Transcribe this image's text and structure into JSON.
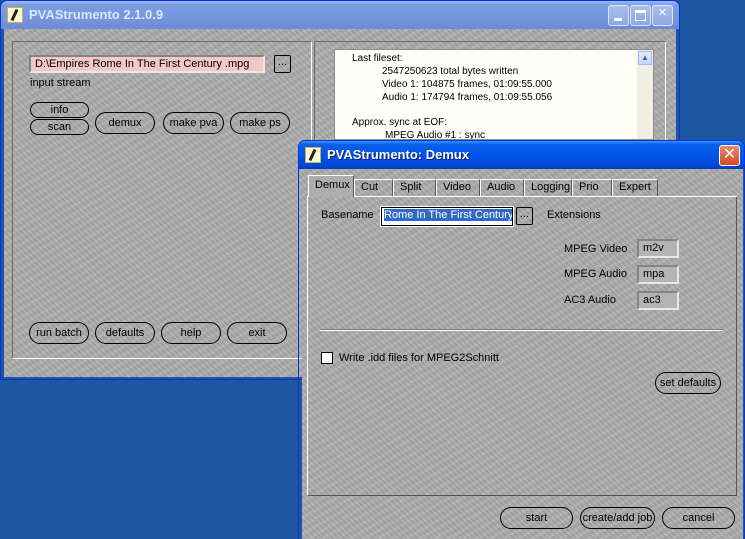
{
  "main_window": {
    "title": "PVAStrumento 2.1.0.9",
    "input_path": "D:\\Empires  Rome In The First Century .mpg",
    "browse_label": "...",
    "input_label": "input stream",
    "buttons": {
      "info": "info",
      "scan": "scan",
      "demux": "demux",
      "make_pva": "make pva",
      "make_ps": "make ps",
      "run_batch": "run batch",
      "defaults": "defaults",
      "help": "help",
      "exit": "exit"
    },
    "log": [
      "Last fileset:",
      "2547250623 total bytes written",
      "Video 1: 104875 frames, 01:09:55.000",
      "Audio 1: 174794 frames, 01:09:55.056",
      "Approx. sync at EOF:",
      "MPEG Audio #1 : sync"
    ],
    "scroll_up_glyph": "▲"
  },
  "demux_window": {
    "title": "PVAStrumento: Demux",
    "close_glyph": "✕",
    "tabs": [
      "Demux",
      "Cut",
      "Split",
      "Video",
      "Audio",
      "Logging",
      "Prio",
      "Expert"
    ],
    "selected_tab": "Demux",
    "basename_label": "Basename",
    "basename_value": "Rome In The First Century",
    "browse_label": "...",
    "extensions_label": "Extensions",
    "mpeg_video_label": "MPEG Video",
    "mpeg_video_value": "m2v",
    "mpeg_audio_label": "MPEG Audio",
    "mpeg_audio_value": "mpa",
    "ac3_audio_label": "AC3 Audio",
    "ac3_audio_value": "ac3",
    "idd_checkbox_label": "Write .idd files for MPEG2Schnitt",
    "idd_checked": false,
    "buttons": {
      "set_defaults": "set defaults",
      "start": "start",
      "create_add_job": "create/add job",
      "cancel": "cancel"
    }
  },
  "colors": {
    "desktop": "#1d56a3",
    "title_active": "#0058ee",
    "title_inactive": "#7a9de0",
    "client_gray": "#adadad",
    "input_field_bg": "#f2c8c8",
    "log_bg": "#fffff7",
    "selection": "#316ac5"
  }
}
